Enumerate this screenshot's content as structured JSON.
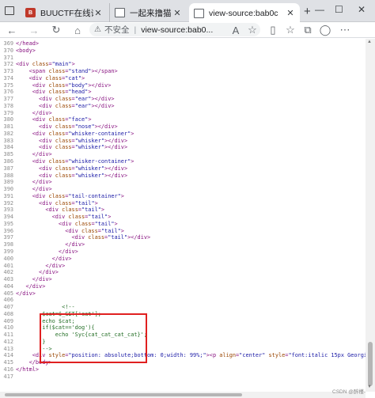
{
  "tabs": [
    {
      "label": "BUUCTF在线评测",
      "favicon": "buuctf-icon"
    },
    {
      "label": "一起来撸猫",
      "favicon": "page-icon"
    },
    {
      "label": "view-source:bab0c",
      "favicon": "page-icon",
      "active": true
    }
  ],
  "window_controls": {
    "minimize": "—",
    "maximize": "☐",
    "close": "✕"
  },
  "toolbar": {
    "security_label": "不安全",
    "url": "view-source:bab0..."
  },
  "source_lines": [
    {
      "n": "369",
      "html": "&lt;/head&gt;"
    },
    {
      "n": "370",
      "html": "&lt;body&gt;"
    },
    {
      "n": "371",
      "html": ""
    },
    {
      "n": "372",
      "html": "&lt;div <span class=\"an\">class</span>=<span class=\"av\">\"main\"</span>&gt;"
    },
    {
      "n": "373",
      "html": "    &lt;span <span class=\"an\">class</span>=<span class=\"av\">\"stand\"</span>&gt;&lt;/span&gt;"
    },
    {
      "n": "374",
      "html": "    &lt;div <span class=\"an\">class</span>=<span class=\"av\">\"cat\"</span>&gt;"
    },
    {
      "n": "375",
      "html": "     &lt;div <span class=\"an\">class</span>=<span class=\"av\">\"body\"</span>&gt;&lt;/div&gt;"
    },
    {
      "n": "376",
      "html": "     &lt;div <span class=\"an\">class</span>=<span class=\"av\">\"head\"</span>&gt;"
    },
    {
      "n": "377",
      "html": "       &lt;div <span class=\"an\">class</span>=<span class=\"av\">\"ear\"</span>&gt;&lt;/div&gt;"
    },
    {
      "n": "378",
      "html": "       &lt;div <span class=\"an\">class</span>=<span class=\"av\">\"ear\"</span>&gt;&lt;/div&gt;"
    },
    {
      "n": "379",
      "html": "     &lt;/div&gt;"
    },
    {
      "n": "380",
      "html": "     &lt;div <span class=\"an\">class</span>=<span class=\"av\">\"face\"</span>&gt;"
    },
    {
      "n": "381",
      "html": "       &lt;div <span class=\"an\">class</span>=<span class=\"av\">\"nose\"</span>&gt;&lt;/div&gt;"
    },
    {
      "n": "382",
      "html": "     &lt;div <span class=\"an\">class</span>=<span class=\"av\">\"whisker-container\"</span>&gt;"
    },
    {
      "n": "383",
      "html": "       &lt;div <span class=\"an\">class</span>=<span class=\"av\">\"whisker\"</span>&gt;&lt;/div&gt;"
    },
    {
      "n": "384",
      "html": "       &lt;div <span class=\"an\">class</span>=<span class=\"av\">\"whisker\"</span>&gt;&lt;/div&gt;"
    },
    {
      "n": "385",
      "html": "     &lt;/div&gt;"
    },
    {
      "n": "386",
      "html": "     &lt;div <span class=\"an\">class</span>=<span class=\"av\">\"whisker-container\"</span>&gt;"
    },
    {
      "n": "387",
      "html": "       &lt;div <span class=\"an\">class</span>=<span class=\"av\">\"whisker\"</span>&gt;&lt;/div&gt;"
    },
    {
      "n": "388",
      "html": "       &lt;div <span class=\"an\">class</span>=<span class=\"av\">\"whisker\"</span>&gt;&lt;/div&gt;"
    },
    {
      "n": "389",
      "html": "     &lt;/div&gt;"
    },
    {
      "n": "390",
      "html": "     &lt;/div&gt;"
    },
    {
      "n": "391",
      "html": "     &lt;div <span class=\"an\">class</span>=<span class=\"av\">\"tail-container\"</span>&gt;"
    },
    {
      "n": "392",
      "html": "       &lt;div <span class=\"an\">class</span>=<span class=\"av\">\"tail\"</span>&gt;"
    },
    {
      "n": "393",
      "html": "         &lt;div <span class=\"an\">class</span>=<span class=\"av\">\"tail\"</span>&gt;"
    },
    {
      "n": "394",
      "html": "           &lt;div <span class=\"an\">class</span>=<span class=\"av\">\"tail\"</span>&gt;"
    },
    {
      "n": "395",
      "html": "             &lt;div <span class=\"an\">class</span>=<span class=\"av\">\"tail\"</span>&gt;"
    },
    {
      "n": "396",
      "html": "               &lt;div <span class=\"an\">class</span>=<span class=\"av\">\"tail\"</span>&gt;"
    },
    {
      "n": "397",
      "html": "                 &lt;div <span class=\"an\">class</span>=<span class=\"av\">\"tail\"</span>&gt;&lt;/div&gt;"
    },
    {
      "n": "398",
      "html": "               &lt;/div&gt;"
    },
    {
      "n": "399",
      "html": "             &lt;/div&gt;"
    },
    {
      "n": "400",
      "html": "           &lt;/div&gt;"
    },
    {
      "n": "401",
      "html": "         &lt;/div&gt;"
    },
    {
      "n": "402",
      "html": "       &lt;/div&gt;"
    },
    {
      "n": "403",
      "html": "     &lt;/div&gt;"
    },
    {
      "n": "404",
      "html": "   &lt;/div&gt;"
    },
    {
      "n": "405",
      "html": "&lt;/div&gt;"
    },
    {
      "n": "406",
      "html": ""
    },
    {
      "n": "407",
      "html": "              <span class=\"cm\">&lt;!--</span>"
    },
    {
      "n": "408",
      "html": "<span class=\"cm\">        $cat=$_GET['cat'];</span>"
    },
    {
      "n": "409",
      "html": "<span class=\"cm\">        echo $cat;</span>"
    },
    {
      "n": "410",
      "html": "<span class=\"cm\">        if($cat=='dog'){</span>"
    },
    {
      "n": "411",
      "html": "<span class=\"cm\">            echo 'Syc{cat_cat_cat_cat}';</span>"
    },
    {
      "n": "412",
      "html": "<span class=\"cm\">        }</span>"
    },
    {
      "n": "413",
      "html": "<span class=\"cm\">        --&gt;</span>"
    },
    {
      "n": "414",
      "html": "     &lt;div <span class=\"an\">style</span>=<span class=\"av\">\"position: absolute;bottom: 0;width: 99%;\"</span>&gt;&lt;p <span class=\"an\">align</span>=<span class=\"av\">\"center\"</span> <span class=\"an\">style</span>=<span class=\"av\">\"font:italic 15px Georgia,se</span>"
    },
    {
      "n": "415",
      "html": "    &lt;/body&gt;"
    },
    {
      "n": "416",
      "html": "&lt;/html&gt;"
    },
    {
      "n": "417",
      "html": ""
    }
  ],
  "watermark": "CSDN @醉槿-"
}
